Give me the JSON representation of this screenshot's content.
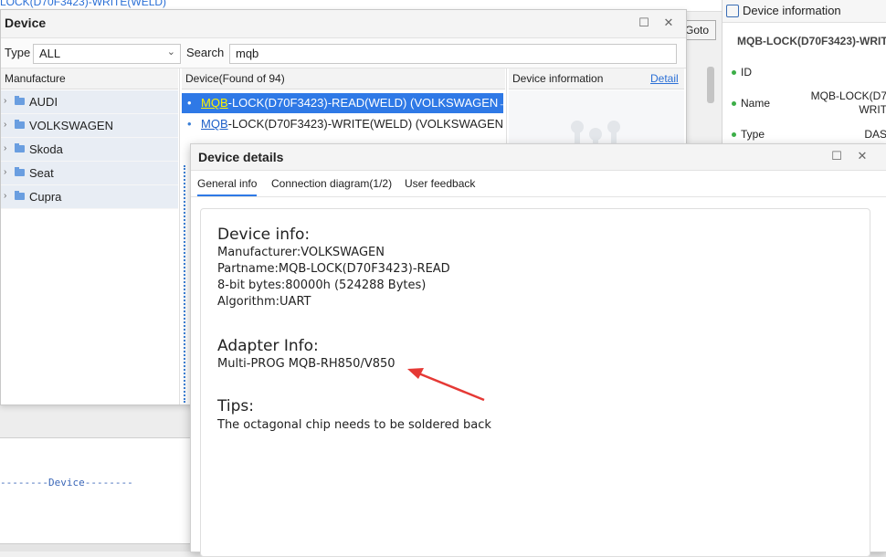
{
  "background": {
    "top_text": "LOCK(D70F3423)-WRITE(WELD)",
    "goto_label": "Goto",
    "device_lower_label": "--------Device--------",
    "info_panel": {
      "title": "Device information",
      "subtitle": "MQB-LOCK(D70F3423)-WRIT",
      "fields": [
        {
          "label": "ID",
          "value": ""
        },
        {
          "label": "Name",
          "value": "MQB-LOCK(D7\nWRIT"
        },
        {
          "label": "Type",
          "value": "DAS"
        }
      ]
    }
  },
  "device_window": {
    "title": "Device",
    "filter": {
      "type_label": "Type",
      "type_value": "ALL",
      "search_label": "Search",
      "search_value": "mqb"
    },
    "columns": {
      "manufacture": "Manufacture",
      "device": "Device(Found of 94)",
      "info": "Device information",
      "detail_link": "Detail"
    },
    "manufacturers": [
      "AUDI",
      "VOLKSWAGEN",
      "Skoda",
      "Seat",
      "Cupra"
    ],
    "devices": [
      {
        "hl": "MQB",
        "rest": "-LOCK(D70F3423)-READ(WELD) (VOLKSWAGEN→...",
        "selected": true
      },
      {
        "hl": "MQB",
        "rest": "-LOCK(D70F3423)-WRITE(WELD) (VOLKSWAGEN...",
        "selected": false
      }
    ]
  },
  "details_dialog": {
    "title": "Device details",
    "tabs": [
      "General info",
      "Connection diagram(1/2)",
      "User feedback"
    ],
    "device_info_heading": "Device info:",
    "device_info_lines": [
      "Manufacturer:VOLKSWAGEN",
      "Partname:MQB-LOCK(D70F3423)-READ",
      "8-bit bytes:80000h (524288 Bytes)",
      "Algorithm:UART"
    ],
    "adapter_heading": "Adapter Info:",
    "adapter_line": "Multi-PROG MQB-RH850/V850",
    "tips_heading": "Tips:",
    "tips_line": "The octagonal chip needs to be soldered back"
  },
  "colors": {
    "selection": "#2f79e6",
    "arrow": "#e53935",
    "folder": "#6a9ee0"
  }
}
